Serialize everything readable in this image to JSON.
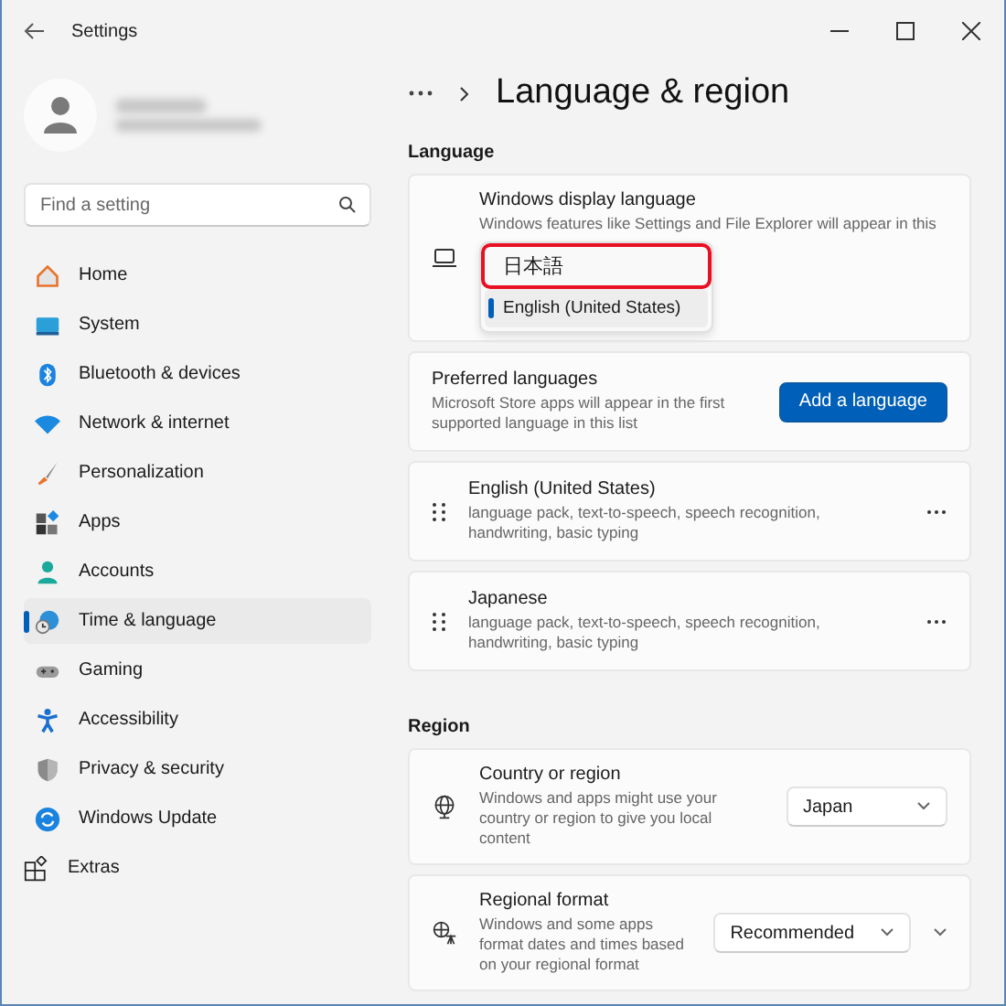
{
  "window": {
    "title": "Settings"
  },
  "search": {
    "placeholder": "Find a setting"
  },
  "sidebar": {
    "items": [
      {
        "label": "Home",
        "selected": false,
        "kind": "page"
      },
      {
        "label": "System",
        "selected": false,
        "kind": "page"
      },
      {
        "label": "Bluetooth & devices",
        "selected": false,
        "kind": "page"
      },
      {
        "label": "Network & internet",
        "selected": false,
        "kind": "page"
      },
      {
        "label": "Personalization",
        "selected": false,
        "kind": "page"
      },
      {
        "label": "Apps",
        "selected": false,
        "kind": "page"
      },
      {
        "label": "Accounts",
        "selected": false,
        "kind": "page"
      },
      {
        "label": "Time & language",
        "selected": true,
        "kind": "page"
      },
      {
        "label": "Gaming",
        "selected": false,
        "kind": "page"
      },
      {
        "label": "Accessibility",
        "selected": false,
        "kind": "page"
      },
      {
        "label": "Privacy & security",
        "selected": false,
        "kind": "page"
      },
      {
        "label": "Windows Update",
        "selected": false,
        "kind": "page"
      },
      {
        "label": "Extras",
        "selected": false,
        "kind": "extra"
      }
    ]
  },
  "header": {
    "title": "Language & region"
  },
  "language": {
    "heading": "Language",
    "display_language": {
      "title": "Windows display language",
      "description": "Windows features like Settings and File Explorer will appear in this",
      "options": [
        {
          "label": "日本語",
          "selected": false,
          "highlighted": true
        },
        {
          "label": "English (United States)",
          "selected": true,
          "highlighted": false
        }
      ]
    },
    "preferred": {
      "title": "Preferred languages",
      "description": "Microsoft Store apps will appear in the first supported language in this list",
      "button": "Add a language"
    },
    "languages": [
      {
        "name": "English (United States)",
        "features": "language pack, text-to-speech, speech recognition, handwriting, basic typing"
      },
      {
        "name": "Japanese",
        "features": "language pack, text-to-speech, speech recognition, handwriting, basic typing"
      }
    ]
  },
  "region": {
    "heading": "Region",
    "settings": [
      {
        "title": "Country or region",
        "description": "Windows and apps might use your country or region to give you local content",
        "value": "Japan",
        "expandable": false
      },
      {
        "title": "Regional format",
        "description": "Windows and some apps format dates and times based on your regional format",
        "value": "Recommended",
        "expandable": true
      }
    ]
  }
}
